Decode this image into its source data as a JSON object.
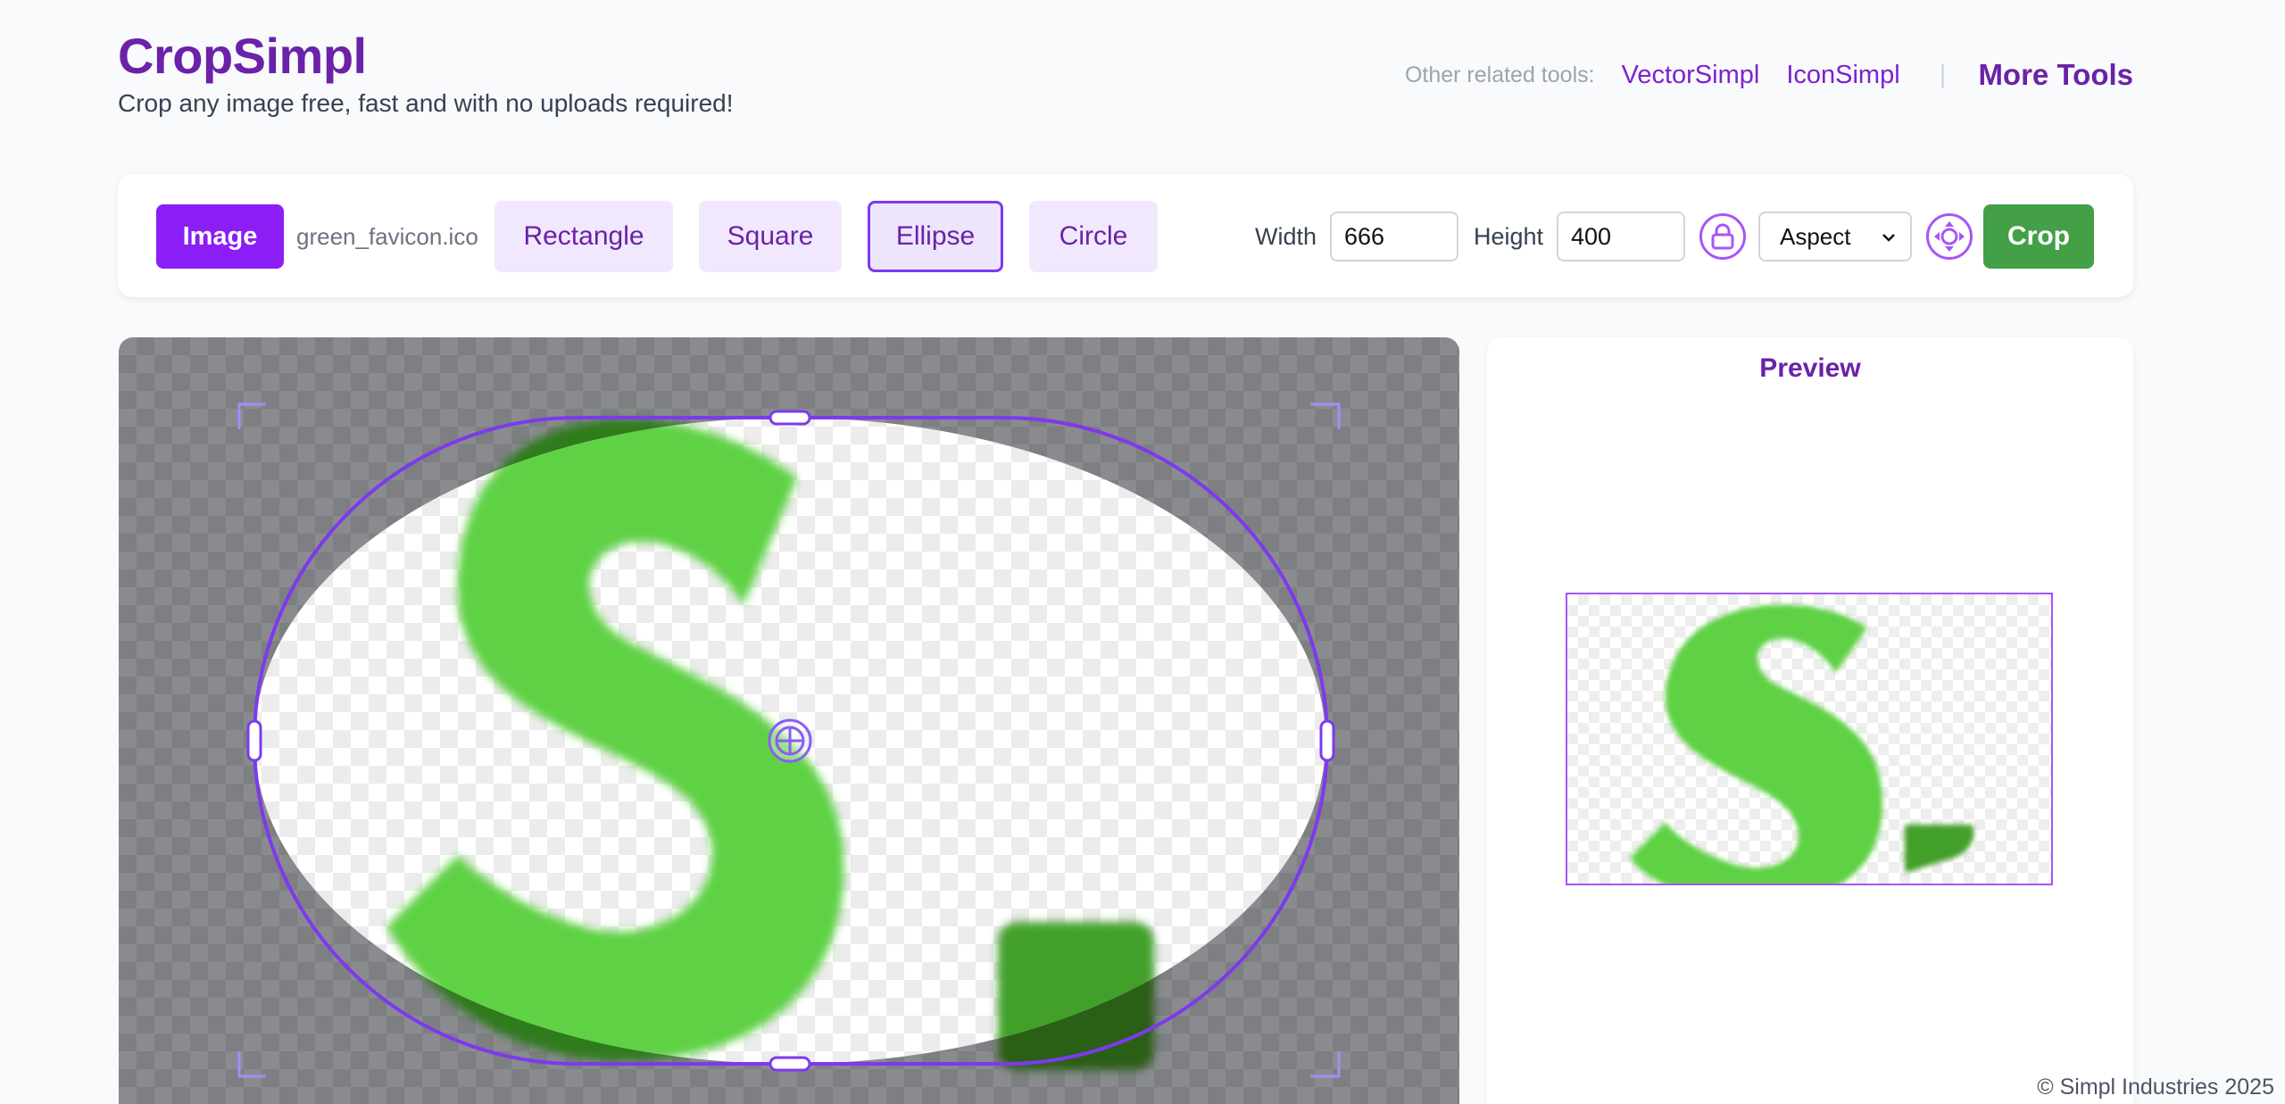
{
  "header": {
    "brand": "CropSimpl",
    "tagline": "Crop any image free, fast and with no uploads required!",
    "related_label": "Other related tools:",
    "related_links": [
      "VectorSimpl",
      "IconSimpl"
    ],
    "separator": "|",
    "more_tools": "More Tools"
  },
  "toolbar": {
    "image_button": "Image",
    "filename": "green_favicon.ico",
    "shapes": [
      "Rectangle",
      "Square",
      "Ellipse",
      "Circle"
    ],
    "active_shape": "Ellipse",
    "width_label": "Width",
    "width_value": "666",
    "height_label": "Height",
    "height_value": "400",
    "aspect_select": "Aspect",
    "crop_button": "Crop"
  },
  "preview": {
    "title": "Preview"
  },
  "colors": {
    "brand": "#6b21a8",
    "accent": "#8b1ef5",
    "crop_green": "#43a047",
    "logo_green": "#5fd145",
    "logo_dark_green": "#43a02a"
  },
  "icons": {
    "lock": "lock-icon",
    "move": "move-arrows-icon",
    "center": "crosshair-icon",
    "chevron": "chevron-down-icon"
  },
  "footer": {
    "copyright": "© Simpl Industries 2025"
  }
}
